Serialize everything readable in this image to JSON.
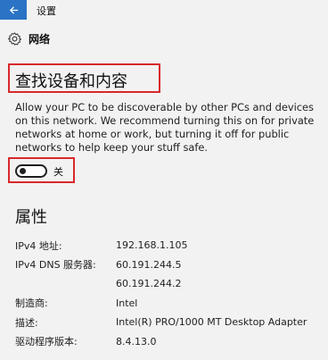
{
  "window": {
    "title": "设置",
    "back_icon": "back-arrow-icon",
    "accent": "#2b73c4"
  },
  "section": {
    "icon": "gear-icon",
    "title": "网络"
  },
  "discovery": {
    "heading": "查找设备和内容",
    "description": "Allow your PC to be discoverable by other PCs and devices on this network. We recommend turning this on for private networks at home or work, but turning it off for public networks to help keep your stuff safe.",
    "toggle": {
      "state": "off",
      "label": "关"
    },
    "highlight_color": "#d9282b"
  },
  "properties": {
    "heading": "属性",
    "rows": [
      {
        "label": "IPv4 地址:",
        "value": "192.168.1.105"
      },
      {
        "label": "IPv4 DNS 服务器:",
        "value": "60.191.244.5"
      },
      {
        "label": "",
        "value": "60.191.244.2"
      },
      {
        "label": "制造商:",
        "value": "Intel"
      },
      {
        "label": "描述:",
        "value": "Intel(R) PRO/1000 MT Desktop Adapter"
      },
      {
        "label": "驱动程序版本:",
        "value": "8.4.13.0"
      }
    ]
  }
}
